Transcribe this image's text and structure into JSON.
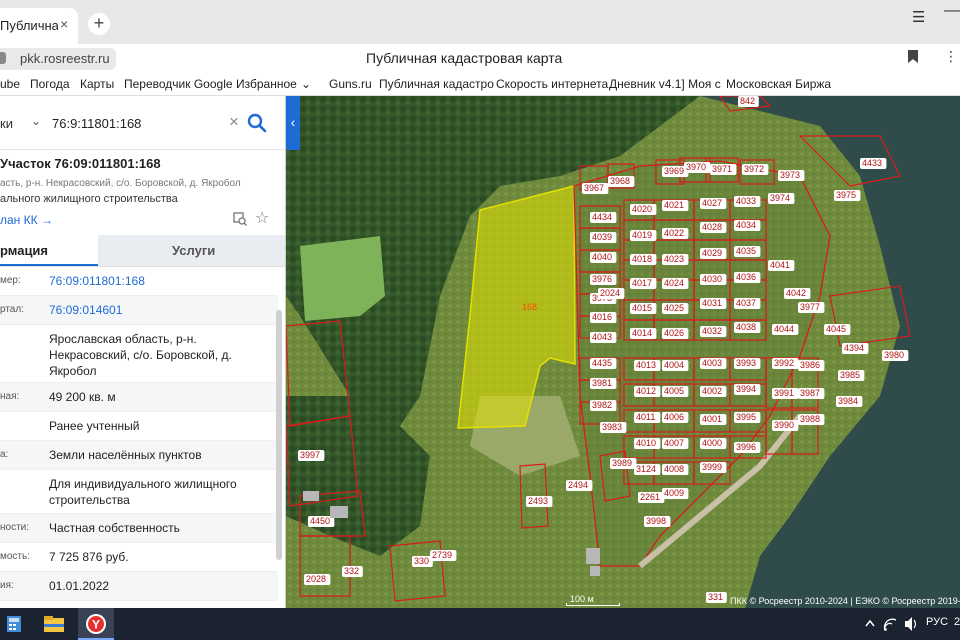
{
  "browser": {
    "tab_title": "Публичная кадастровая",
    "tab_close": "×",
    "new_tab": "+",
    "menu": "☰",
    "minimize": "—",
    "url": "pkk.rosreestr.ru",
    "page_title": "Публичная кадастровая карта",
    "kebab": "⋮",
    "bookmarks": [
      "ube",
      "Погода",
      "Карты",
      "Переводчик Google",
      "Избранное",
      "Guns.ru",
      "Публичная кадастро",
      "Скорость интернета",
      "Дневник v4.1] Моя с",
      "Московская Биржа"
    ],
    "favorites_chevron": "⌄"
  },
  "panel": {
    "search_scope": "ки",
    "search_value": "76:9:11801:168",
    "clear": "×",
    "collapse": "‹",
    "object_title": "Участок 76:09:011801:168",
    "object_address": "асть, р-н. Некрасовский, с/о. Боровской, д. Якробол",
    "object_use": "ального жилищного строительства",
    "plan_link": "лан КК →",
    "star": "☆",
    "tab_info": "рмация",
    "tab_services": "Услуги",
    "rows": [
      {
        "label": "мер:",
        "value": "76:09:011801:168",
        "link": true,
        "h": 29
      },
      {
        "label": "ртал:",
        "value": "76:09:014601",
        "link": true,
        "h": 29
      },
      {
        "label": "",
        "value": "Ярославская область, р-н. Некрасовский, с/о. Боровской, д. Якробол",
        "link": false,
        "h": 58
      },
      {
        "label": "ная:",
        "value": "49 200 кв. м",
        "link": false,
        "h": 29
      },
      {
        "label": "",
        "value": "Ранее учтенный",
        "link": false,
        "h": 29
      },
      {
        "label": "а:",
        "value": "Земли населённых пунктов",
        "link": false,
        "h": 29
      },
      {
        "label": "",
        "value": "Для индивидуального жилищного строительства",
        "link": false,
        "h": 44
      },
      {
        "label": "ности:",
        "value": "Частная собственность",
        "link": false,
        "h": 29
      },
      {
        "label": "мость:",
        "value": "7 725 876 руб.",
        "link": false,
        "h": 29
      },
      {
        "label": "ия:",
        "value": "01.01.2022",
        "link": false,
        "h": 29
      }
    ]
  },
  "map": {
    "selected_label": "168",
    "parcels": [
      "842",
      "4433",
      "3967",
      "3968",
      "3969",
      "3970",
      "3971",
      "3972",
      "3973",
      "3974",
      "3975",
      "4434",
      "4020",
      "4021",
      "4027",
      "4033",
      "4039",
      "4019",
      "4022",
      "4028",
      "4034",
      "4040",
      "4018",
      "4023",
      "4029",
      "4035",
      "4041",
      "3976",
      "4017",
      "4024",
      "4030",
      "4036",
      "4042",
      "3977",
      "3978",
      "4016",
      "4015",
      "4025",
      "4031",
      "4037",
      "4043",
      "4014",
      "4026",
      "4032",
      "4038",
      "4044",
      "4045",
      "4394",
      "3980",
      "4435",
      "4013",
      "4004",
      "4003",
      "3993",
      "3992",
      "3986",
      "3985",
      "3981",
      "4012",
      "4005",
      "4002",
      "3994",
      "3991",
      "3987",
      "3984",
      "3982",
      "4011",
      "4006",
      "4001",
      "3995",
      "3990",
      "3988",
      "3983",
      "4010",
      "4007",
      "4000",
      "3996",
      "3989",
      "3124",
      "4008",
      "3999",
      "3997",
      "2494",
      "2493",
      "2261",
      "4009",
      "3998",
      "4450",
      "2028",
      "332",
      "330",
      "2739",
      "331",
      "2024"
    ],
    "scale_label": "100 м",
    "attribution": "ПКК © Росреестр 2010-2024 | ЕЭКО © Росреестр 2019-"
  },
  "taskbar": {
    "lang": "РУС",
    "clock": "2"
  },
  "colors": {
    "accent": "#1e6bd6",
    "parcel_border": "#d81c1c",
    "selected_fill": "#e3e100"
  }
}
